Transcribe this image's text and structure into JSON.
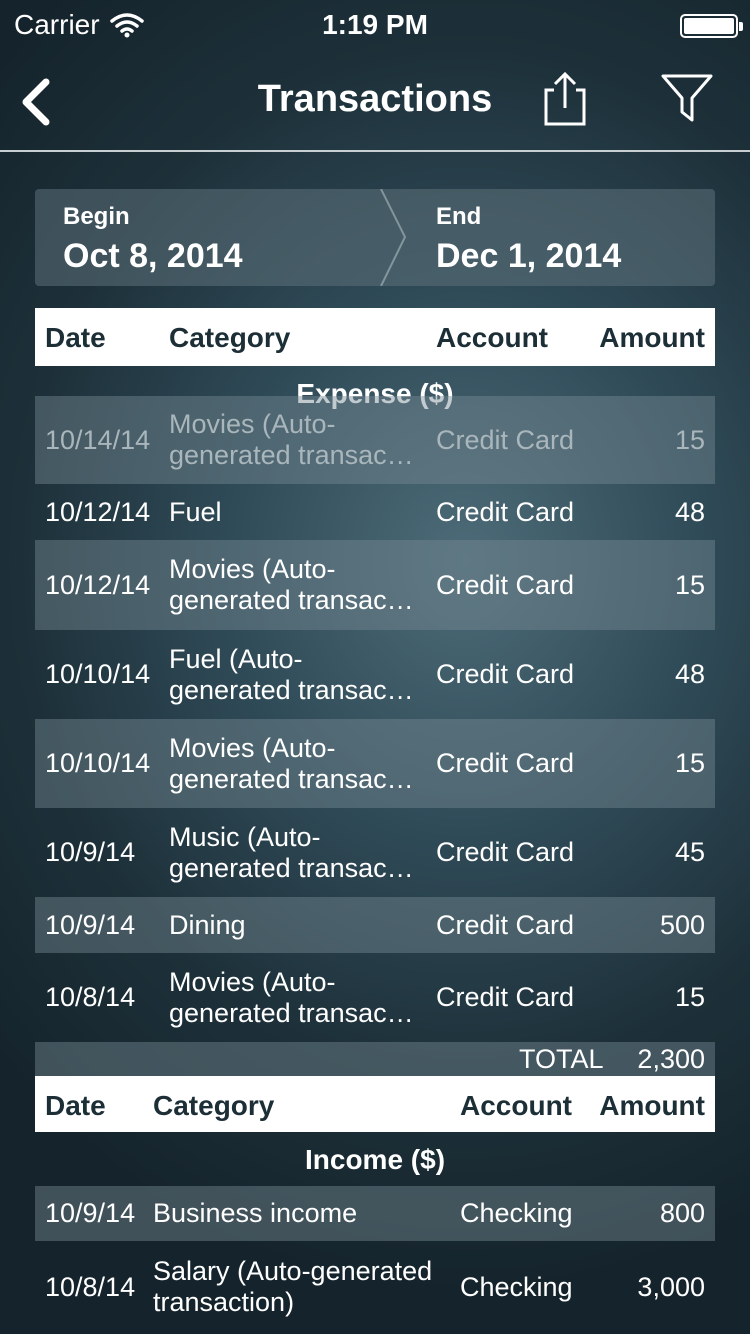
{
  "status": {
    "carrier": "Carrier",
    "time": "1:19 PM"
  },
  "nav": {
    "title": "Transactions",
    "back_icon": "chevron-left-icon",
    "share_icon": "share-icon",
    "filter_icon": "filter-icon"
  },
  "range": {
    "begin_label": "Begin",
    "begin_value": "Oct 8, 2014",
    "end_label": "End",
    "end_value": "Dec 1, 2014"
  },
  "expense": {
    "headers": {
      "date": "Date",
      "category": "Category",
      "account": "Account",
      "amount": "Amount"
    },
    "title": "Expense ($)",
    "rows": [
      {
        "date": "10/14/14",
        "category": "Movies (Auto-\ngenerated transac…",
        "account": "Credit Card",
        "amount": "15"
      },
      {
        "date": "10/12/14",
        "category": "Fuel",
        "account": "Credit Card",
        "amount": "48"
      },
      {
        "date": "10/12/14",
        "category": "Movies (Auto-\ngenerated transac…",
        "account": "Credit Card",
        "amount": "15"
      },
      {
        "date": "10/10/14",
        "category": "Fuel (Auto-\ngenerated transac…",
        "account": "Credit Card",
        "amount": "48"
      },
      {
        "date": "10/10/14",
        "category": "Movies (Auto-\ngenerated transac…",
        "account": "Credit Card",
        "amount": "15"
      },
      {
        "date": "10/9/14",
        "category": "Music (Auto-\ngenerated transac…",
        "account": "Credit Card",
        "amount": "45"
      },
      {
        "date": "10/9/14",
        "category": "Dining",
        "account": "Credit Card",
        "amount": "500"
      },
      {
        "date": "10/8/14",
        "category": "Movies (Auto-\ngenerated transac…",
        "account": "Credit Card",
        "amount": "15"
      }
    ],
    "total_label": "TOTAL",
    "total_value": "2,300"
  },
  "income": {
    "headers": {
      "date": "Date",
      "category": "Category",
      "account": "Account",
      "amount": "Amount"
    },
    "title": "Income ($)",
    "rows": [
      {
        "date": "10/9/14",
        "category": "Business income",
        "account": "Checking",
        "amount": "800"
      },
      {
        "date": "10/8/14",
        "category": "Salary (Auto-generated\ntransaction)",
        "account": "Checking",
        "amount": "3,000"
      }
    ]
  }
}
